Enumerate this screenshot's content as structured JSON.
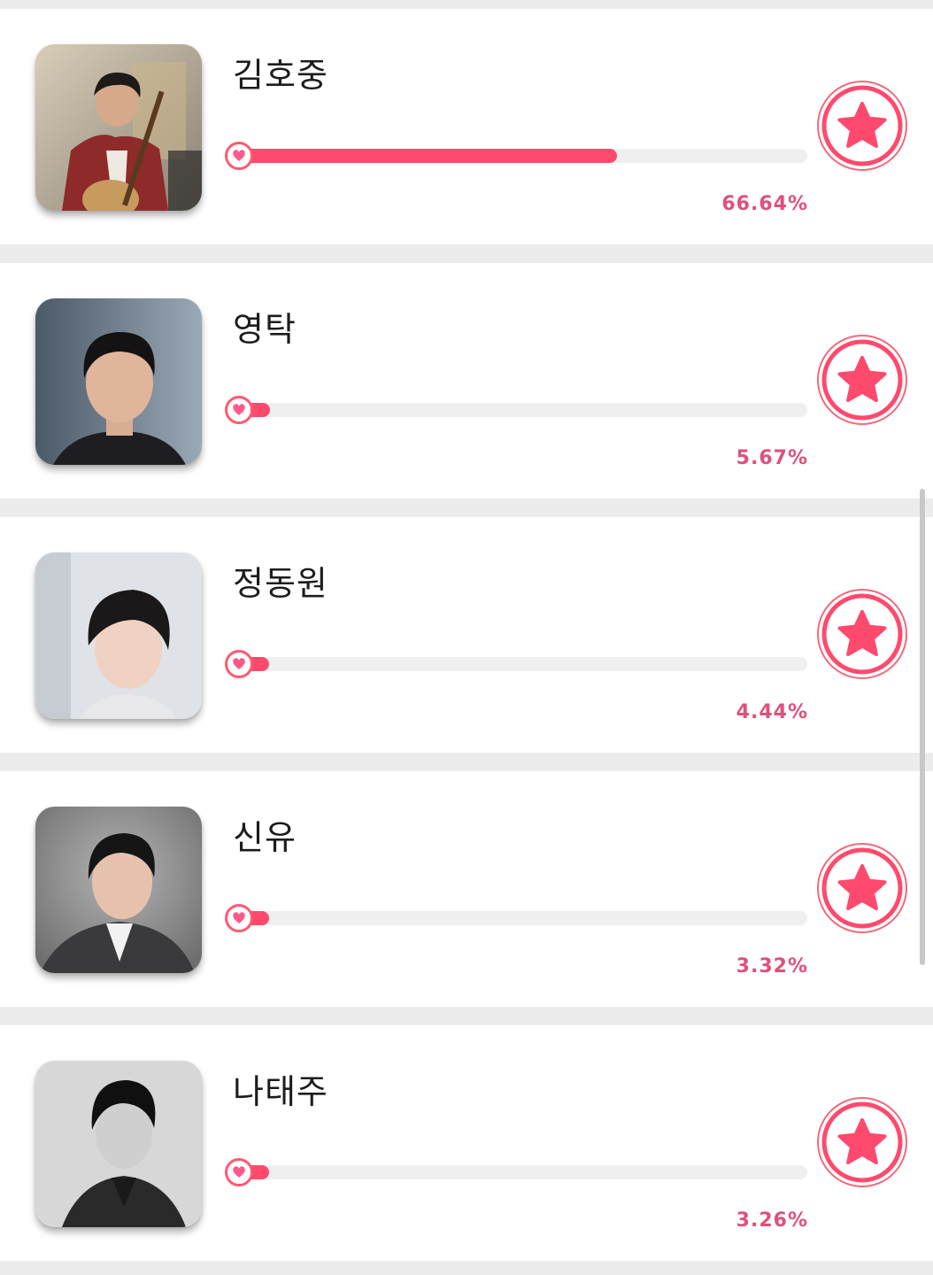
{
  "colors": {
    "accent": "#ff4a6e",
    "percent_text": "#e0507a",
    "track": "#efefef",
    "separator": "#ececec"
  },
  "candidates": [
    {
      "name": "김호중",
      "percent_label": "66.64%",
      "percent": 66.64,
      "avatar": "portrait-photo",
      "vote_icon": "star-icon"
    },
    {
      "name": "영탁",
      "percent_label": "5.67%",
      "percent": 5.67,
      "avatar": "portrait-photo",
      "vote_icon": "star-icon"
    },
    {
      "name": "정동원",
      "percent_label": "4.44%",
      "percent": 4.44,
      "avatar": "portrait-photo",
      "vote_icon": "star-icon"
    },
    {
      "name": "신유",
      "percent_label": "3.32%",
      "percent": 3.32,
      "avatar": "portrait-photo",
      "vote_icon": "star-icon"
    },
    {
      "name": "나태주",
      "percent_label": "3.26%",
      "percent": 3.26,
      "avatar": "portrait-photo",
      "vote_icon": "star-icon"
    }
  ]
}
